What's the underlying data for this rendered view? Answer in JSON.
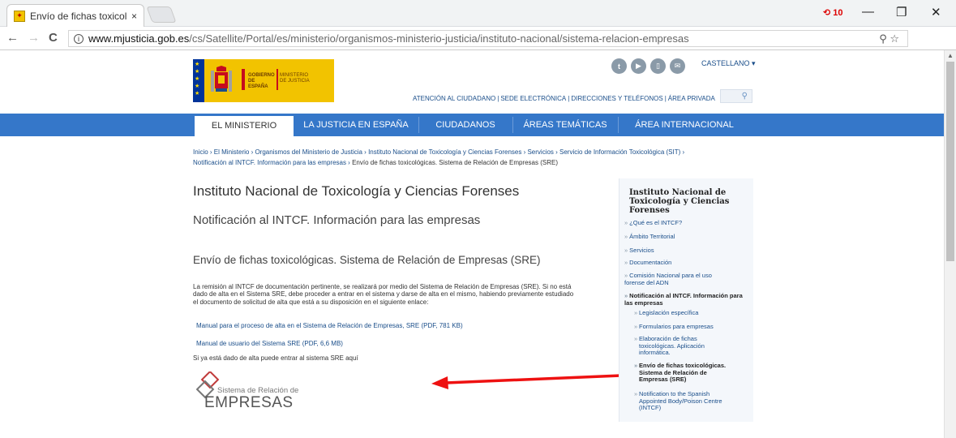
{
  "browser": {
    "tab_title": "Envío de fichas toxicológ",
    "tab_close": "×",
    "url_host": "www.mjusticia.gob.es",
    "url_path": "/cs/Satellite/Portal/es/ministerio/organismos-ministerio-justicia/instituto-nacional/sistema-relacion-empresas",
    "ext_badge": "⟲ 10",
    "nav": {
      "back": "←",
      "forward": "→",
      "reload": "C"
    },
    "omni_icons": "⚲ ☆",
    "window": {
      "minimize": "—",
      "maximize": "❐",
      "close": "✕"
    }
  },
  "header": {
    "logo_gobierno": "GOBIERNO DE ESPAÑA",
    "logo_ministerio": "MINISTERIO DE JUSTICIA",
    "language": "CASTELLANO ▾",
    "social": [
      "t",
      "▶",
      "▯",
      "✉"
    ],
    "toplinks": [
      "ATENCIÓN AL CIUDADANO",
      "SEDE ELECTRÓNICA",
      "DIRECCIONES Y TELÉFONOS",
      "ÁREA PRIVADA"
    ],
    "search_icon": "⚲"
  },
  "nav": {
    "items": [
      "EL MINISTERIO",
      "LA JUSTICIA EN ESPAÑA",
      "CIUDADANOS",
      "ÁREAS TEMÁTICAS",
      "ÁREA INTERNACIONAL"
    ]
  },
  "breadcrumb": {
    "links": "Inicio ›  El Ministerio ›  Organismos del Ministerio de Justicia ›  Instituto Nacional de Toxicología y Ciencias Forenses ›  Servicios ›  Servicio de Información Toxicológica (SIT) ›",
    "links2": "Notificación al INTCF. Información para las empresas ›",
    "current": "Envío de fichas toxicológicas. Sistema de Relación de Empresas (SRE)"
  },
  "main": {
    "title": "Instituto Nacional de Toxicología y Ciencias Forenses",
    "subtitle": "Notificación al INTCF. Información para las empresas",
    "section_title": "Envío de fichas toxicológicas. Sistema de Relación de Empresas (SRE)",
    "paragraph": "La remisión al INTCF de documentación pertinente, se realizará por medio del Sistema de Relación de Empresas (SRE). Si no está dado de alta en el Sistema SRE, debe proceder a entrar en el sistema y darse de alta en el mismo, habiendo previamente estudiado el documento de solicitud de alta que está a su disposición en el siguiente enlace:",
    "link_manual_alta": "Manual para el proceso de alta en el Sistema de Relación de Empresas, SRE (PDF, 781 KB)",
    "link_manual_usuario": "Manual de usuario del Sistema SRE (PDF, 6,6 MB)",
    "paragraph2": "Si ya está dado de alta puede entrar al sistema SRE aquí",
    "sre_logo_small": "Sistema de Relación de",
    "sre_logo_big": "EMPRESAS"
  },
  "sidebar": {
    "title": "Instituto Nacional de Toxicología y Ciencias Forenses",
    "items": [
      "¿Qué es el INTCF?",
      "Ámbito Territorial",
      "Servicios",
      "Documentación",
      "Comisión Nacional para el uso forense del ADN",
      "Notificación al INTCF. Información para las empresas"
    ],
    "subitems": [
      "Legislación específica",
      "Formularios para empresas",
      "Elaboración de fichas toxicológicas. Aplicación informática.",
      "Envío de fichas toxicológicas. Sistema de Relación de Empresas (SRE)",
      "Notification to the Spanish Appointed Body/Poison Centre (INTCF)"
    ]
  }
}
